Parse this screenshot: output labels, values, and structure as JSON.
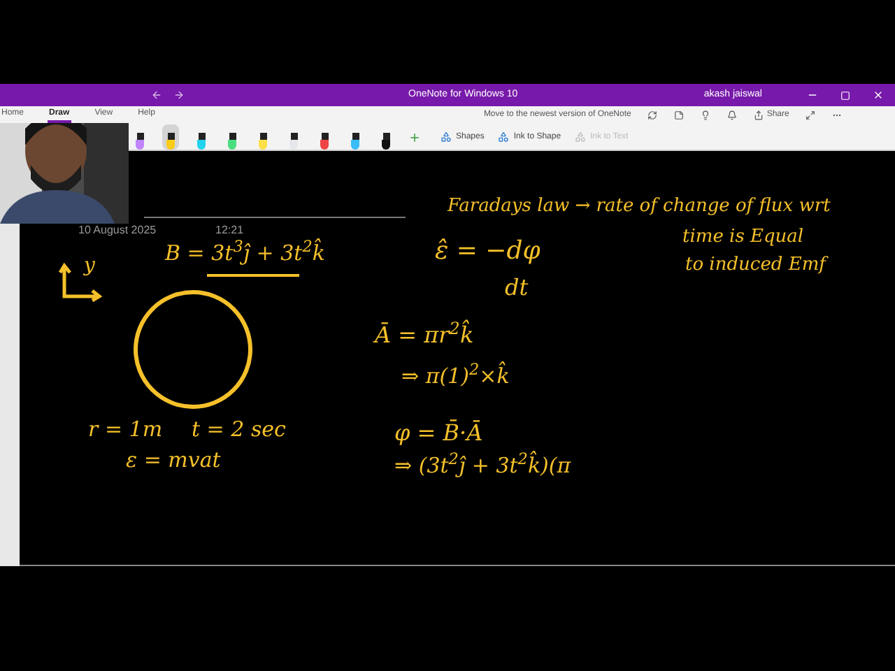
{
  "window": {
    "title": "OneNote for Windows 10",
    "user": "akash jaiswal"
  },
  "tabs": [
    {
      "label": "Home",
      "selected": false
    },
    {
      "label": "Draw",
      "selected": true
    },
    {
      "label": "View",
      "selected": false
    },
    {
      "label": "Help",
      "selected": false
    }
  ],
  "notice": "Move to the newest version of OneNote",
  "share": "Share",
  "pens": [
    {
      "color": "#c084fc",
      "selected": false
    },
    {
      "color": "#facc15",
      "selected": true
    },
    {
      "color": "#22d3ee",
      "selected": false
    },
    {
      "color": "#4ade80",
      "selected": false
    },
    {
      "color": "#fde047",
      "selected": false
    },
    {
      "color": "#e5e7eb",
      "selected": false
    },
    {
      "color": "#ef4444",
      "selected": false
    },
    {
      "color": "#38bdf8",
      "selected": false
    },
    {
      "color": "#111111",
      "selected": false
    }
  ],
  "tools": [
    {
      "label": "Shapes",
      "disabled": false
    },
    {
      "label": "Ink to Shape",
      "disabled": false
    },
    {
      "label": "Ink to Text",
      "disabled": true
    }
  ],
  "page": {
    "date": "10 August 2025",
    "time": "12:21"
  },
  "ink": [
    {
      "kind": "axes",
      "text": "y"
    },
    {
      "kind": "text",
      "text": "B = 3t$^{3}$ĵ + 3t$^{2}$k̂"
    },
    {
      "kind": "circle"
    },
    {
      "kind": "text",
      "text": "r = 1m"
    },
    {
      "kind": "text",
      "text": "t = 2 sec"
    },
    {
      "kind": "text",
      "text": "ε = mvat"
    },
    {
      "kind": "text",
      "text": "Faradays law → rate of change of flux wrt"
    },
    {
      "kind": "text",
      "text": "ε̂ = −dφ"
    },
    {
      "kind": "text",
      "text": "time is Equal"
    },
    {
      "kind": "text",
      "text": "to induced Emf"
    },
    {
      "kind": "text",
      "text": "dt"
    },
    {
      "kind": "text",
      "text": "Ā = πr$^{2}$k̂"
    },
    {
      "kind": "text",
      "text": "⇒ π(1)$^{2}$×k̂"
    },
    {
      "kind": "text",
      "text": "φ = B̄·Ā"
    },
    {
      "kind": "text",
      "text": "⇒ (3t$^{2}$ĵ + 3t$^{2}$k̂)(π"
    }
  ]
}
